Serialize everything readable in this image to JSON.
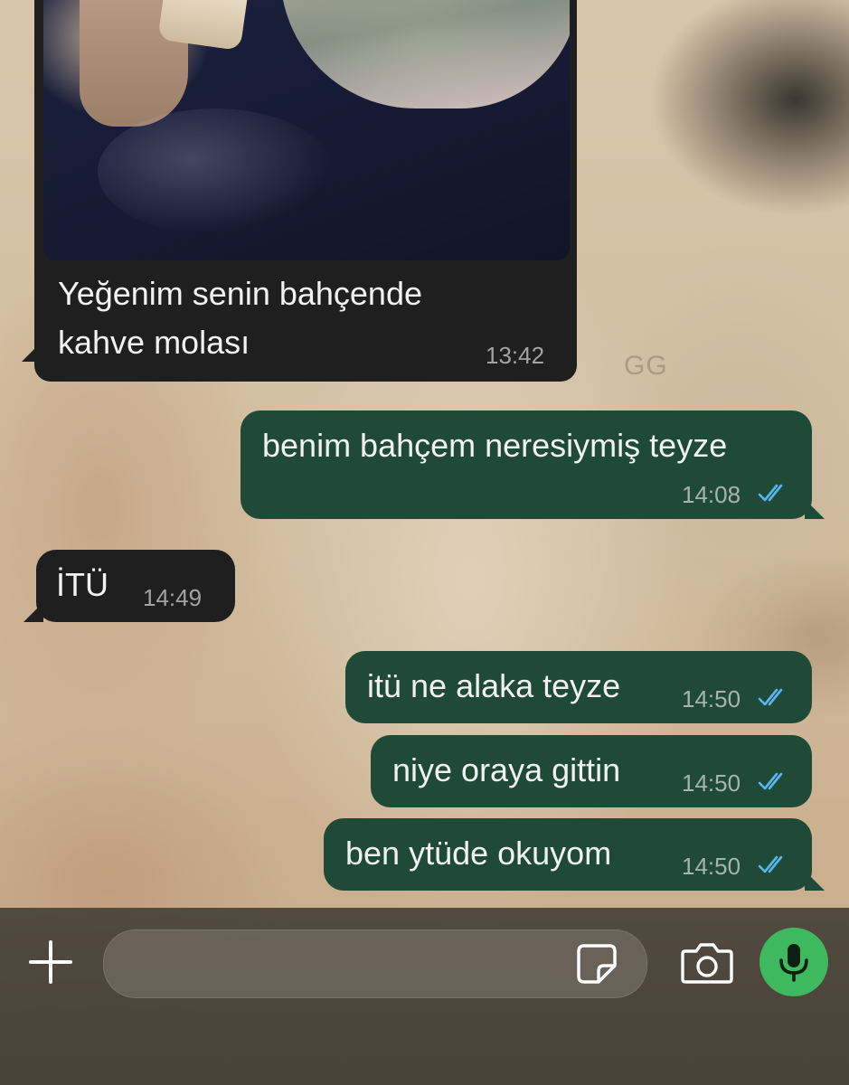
{
  "wallpaper": {
    "mark_text": "GG"
  },
  "messages": [
    {
      "id": "m1",
      "direction": "incoming",
      "has_photo": true,
      "text_lines": [
        "Yeğenim senin bahçende",
        "kahve molası"
      ],
      "time": "13:42"
    },
    {
      "id": "m2",
      "direction": "outgoing",
      "text": "benim bahçem neresiymiş teyze",
      "time": "14:08",
      "status": "read"
    },
    {
      "id": "m3",
      "direction": "incoming",
      "text": "İTÜ",
      "time": "14:49"
    },
    {
      "id": "m4",
      "direction": "outgoing",
      "text": "itü ne alaka teyze",
      "time": "14:50",
      "status": "read"
    },
    {
      "id": "m5",
      "direction": "outgoing",
      "text": "niye oraya gittin",
      "time": "14:50",
      "status": "read"
    },
    {
      "id": "m6",
      "direction": "outgoing",
      "text": "ben ytüde okuyom",
      "time": "14:50",
      "status": "read"
    }
  ],
  "composer": {
    "attach_icon": "plus-icon",
    "sticker_icon": "sticker-icon",
    "camera_icon": "camera-icon",
    "mic_icon": "microphone-icon",
    "value": "",
    "placeholder": ""
  },
  "colors": {
    "incoming_bubble": "#1f1f1f",
    "outgoing_bubble": "#1f4a37",
    "read_ticks": "#58b6f0",
    "mic_button": "#3fb95e"
  }
}
